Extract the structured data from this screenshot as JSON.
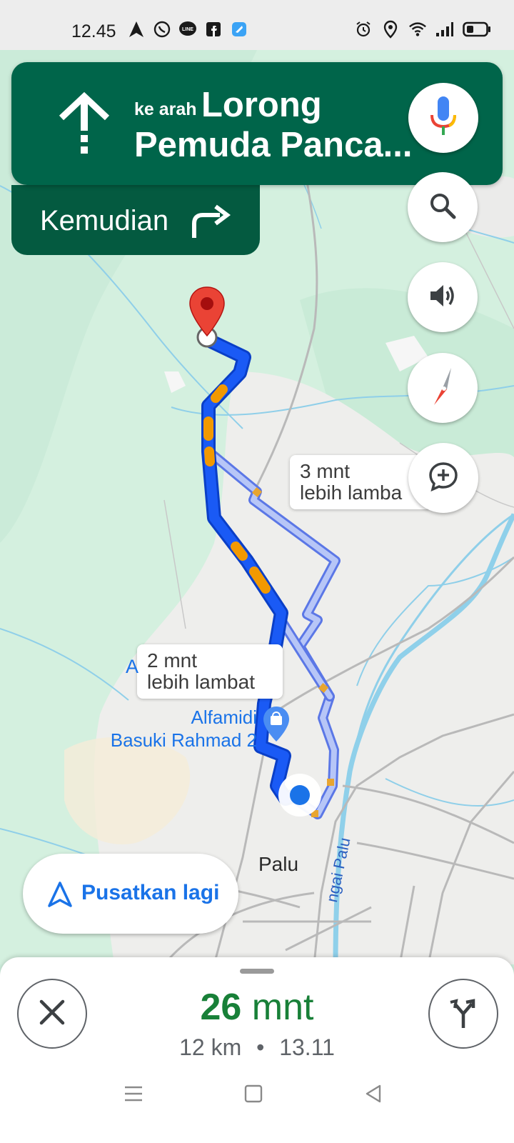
{
  "status_bar": {
    "time": "12.45",
    "left_icons": [
      "navigation-arrow-icon",
      "whatsapp-icon",
      "line-icon",
      "facebook-icon",
      "app-icon"
    ],
    "right_icons": [
      "alarm-icon",
      "location-icon",
      "wifi-icon",
      "signal-icon",
      "battery-icon"
    ]
  },
  "navigation": {
    "direction_icon": "straight-arrow-icon",
    "prefix": "ke arah",
    "street_line1": "Lorong",
    "street_line2": "Pemuda Panca...",
    "then_label": "Kemudian",
    "then_icon": "turn-right-icon"
  },
  "map_controls": [
    "mic-icon",
    "search-icon",
    "volume-icon",
    "compass-icon",
    "add-report-icon"
  ],
  "callouts": {
    "alt_route_1": {
      "line1": "3 mnt",
      "line2": "lebih lamba"
    },
    "alt_route_2": {
      "line1": "2 mnt",
      "line2": "lebih lambat"
    }
  },
  "map_labels": {
    "poi_line1": "Alfamidi",
    "poi_line2": "Basuki Rahmad 2",
    "city": "Palu",
    "river": "ngai Palu",
    "partial_a": "A"
  },
  "recenter": {
    "label": "Pusatkan lagi"
  },
  "trip": {
    "eta_number": "26",
    "eta_unit": "mnt",
    "distance": "12 km",
    "separator": "•",
    "arrival": "13.11"
  },
  "colors": {
    "nav_green": "#00654a",
    "route_blue": "#1a50f0",
    "traffic_orange": "#f29900",
    "eta_green": "#188038",
    "accent_blue": "#1a73e8"
  }
}
